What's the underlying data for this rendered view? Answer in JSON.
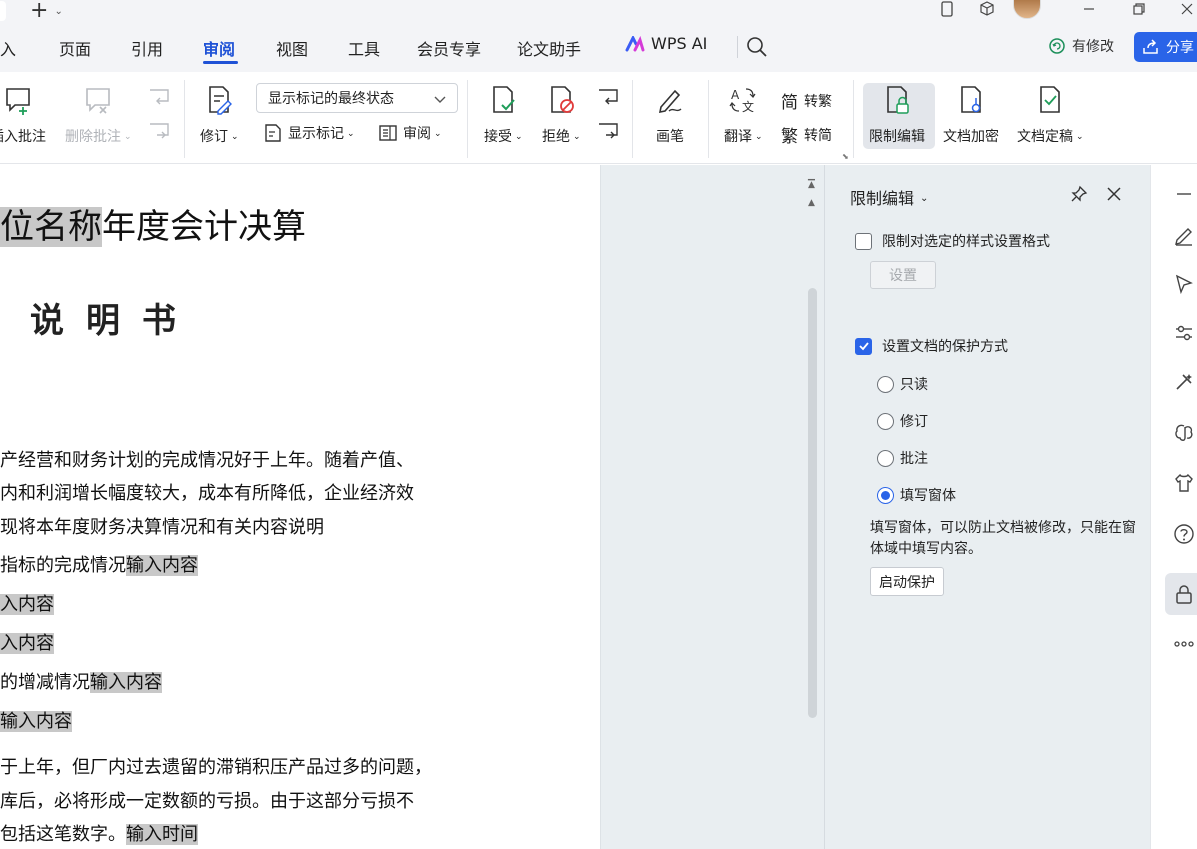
{
  "menubar": {
    "items": [
      "插入",
      "页面",
      "引用",
      "审阅",
      "视图",
      "工具",
      "会员专享",
      "论文助手"
    ],
    "active_index": 3,
    "wps_ai": "WPS AI",
    "status": "有修改",
    "share": "分享"
  },
  "ribbon": {
    "insert_comment": "插入批注",
    "delete_comment": "删除批注",
    "revise": "修订",
    "markup_select": "显示标记的最终状态",
    "show_markup": "显示标记",
    "review": "审阅",
    "accept": "接受",
    "reject": "拒绝",
    "pen": "画笔",
    "translate": "翻译",
    "to_traditional": "转繁",
    "to_simplified": "转简",
    "to_traditional_glyph": "简",
    "to_simplified_glyph": "繁",
    "restrict_edit": "限制编辑",
    "encrypt": "文档加密",
    "finalize": "文档定稿"
  },
  "document": {
    "title_highlight": "位名称",
    "title_rest": "年度会计决算",
    "subtitle": "说明书",
    "lines": [
      {
        "text": "产经营和财务计划的完成情况好于上年。随着产值、",
        "hl": ""
      },
      {
        "text": "内和利润增长幅度较大，成本有所降低，企业经济效",
        "hl": ""
      },
      {
        "text": "现将本年度财务决算情况和有关内容说明",
        "hl": ""
      },
      {
        "text": "指标的完成情况",
        "hl": "输入内容"
      },
      {
        "text": "",
        "hl": "入内容"
      },
      {
        "text": "",
        "hl": "入内容"
      },
      {
        "text": "的增减情况",
        "hl": "输入内容"
      },
      {
        "text": "",
        "hl": "输入内容"
      },
      {
        "text": "于上年，但厂内过去遗留的滞销积压产品过多的问题，",
        "hl": ""
      },
      {
        "text": "库后，必将形成一定数额的亏损。由于这部分亏损不",
        "hl": ""
      },
      {
        "text": "包括这笔数字。",
        "hl": "输入时间"
      }
    ]
  },
  "pane": {
    "title": "限制编辑",
    "restrict_format_label": "限制对选定的样式设置格式",
    "restrict_format_checked": false,
    "settings_button": "设置",
    "protect_label": "设置文档的保护方式",
    "protect_checked": true,
    "options": [
      "只读",
      "修订",
      "批注",
      "填写窗体"
    ],
    "selected_option": "填写窗体",
    "description": "填写窗体，可以防止文档被修改，只能在窗体域中填写内容。",
    "start_button": "启动保护"
  },
  "colors": {
    "accent": "#2a64e8",
    "active_tab": "#1f52d6",
    "field_highlight": "#c8c8c8",
    "pane_bg": "#e9eef1"
  }
}
